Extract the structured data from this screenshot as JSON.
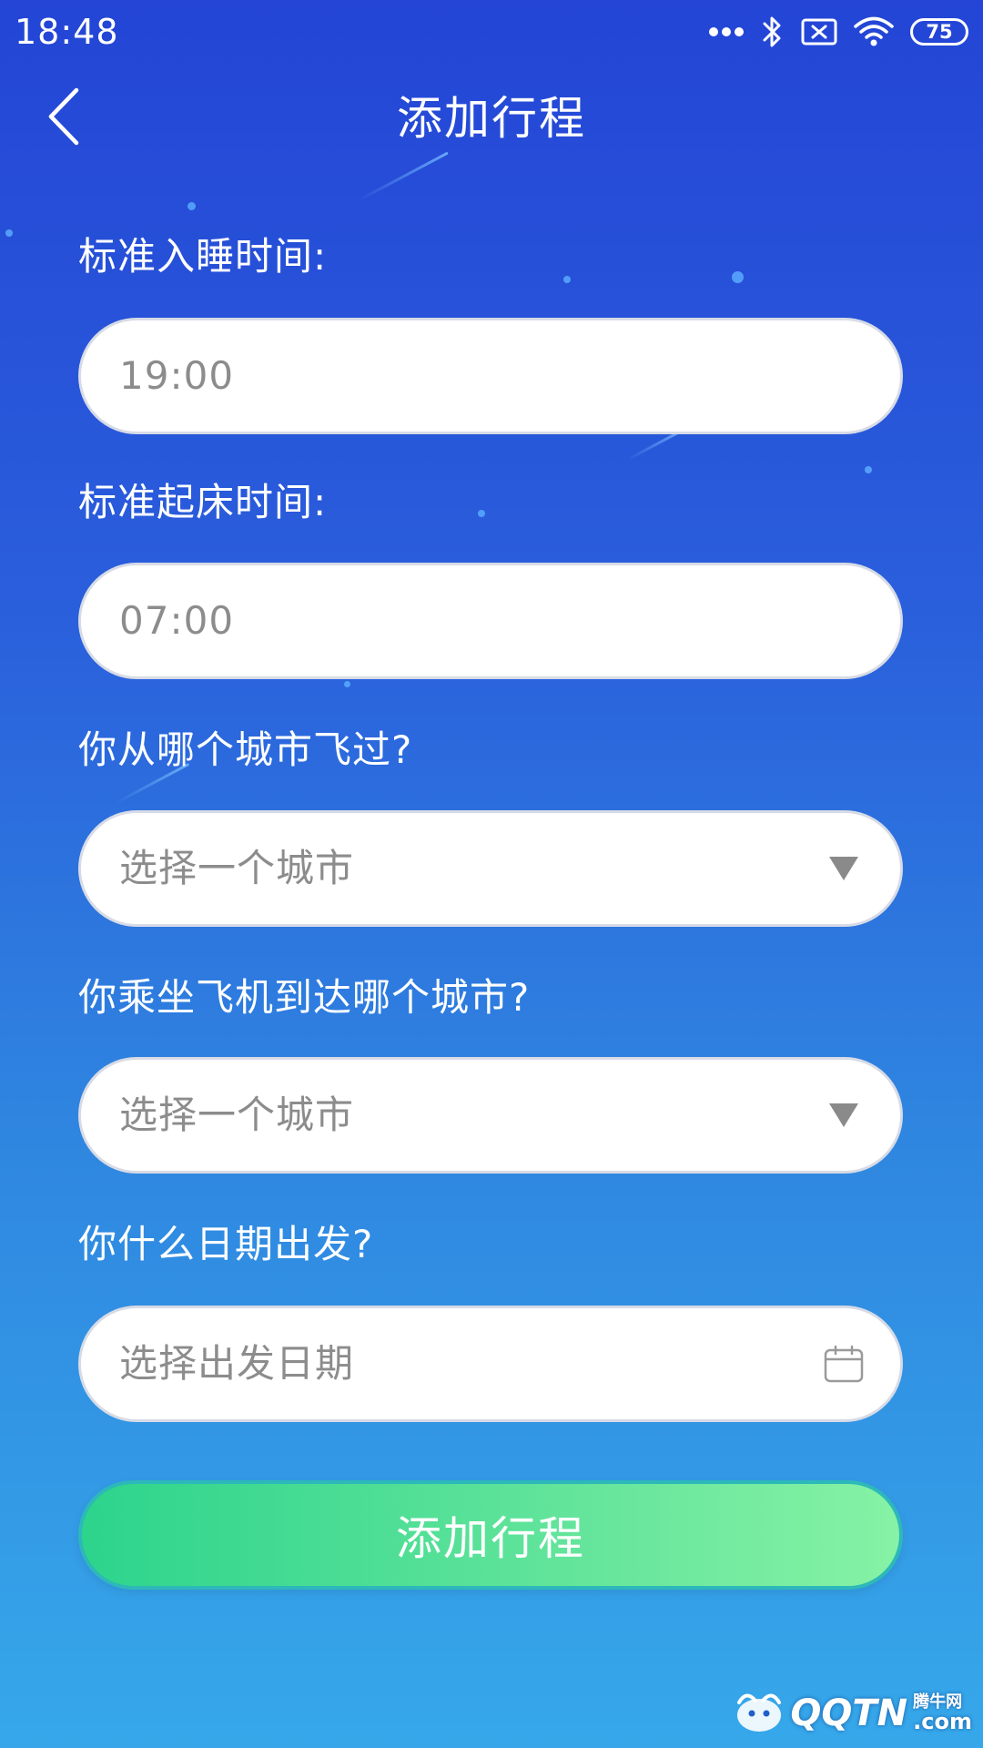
{
  "status_bar": {
    "time": "18:48",
    "battery": "75",
    "icons": [
      "more-dots-icon",
      "bluetooth-icon",
      "no-sim-icon",
      "wifi-icon",
      "battery-icon"
    ]
  },
  "header": {
    "title": "添加行程",
    "back_icon": "chevron-left-icon"
  },
  "form": {
    "sleep_time": {
      "label": "标准入睡时间:",
      "value": "19:00"
    },
    "wake_time": {
      "label": "标准起床时间:",
      "value": "07:00"
    },
    "departure_city": {
      "label": "你从哪个城市飞过?",
      "placeholder": "选择一个城市",
      "icon": "dropdown-triangle-icon"
    },
    "arrival_city": {
      "label": "你乘坐飞机到达哪个城市?",
      "placeholder": "选择一个城市",
      "icon": "dropdown-triangle-icon"
    },
    "departure_date": {
      "label": "你什么日期出发?",
      "placeholder": "选择出发日期",
      "icon": "calendar-icon"
    }
  },
  "submit": {
    "label": "添加行程"
  },
  "watermark": {
    "text": "QQTN",
    "suffix": ".com",
    "small": "腾牛网"
  },
  "colors": {
    "background_top": "#2445d6",
    "background_bottom": "#36a8ea",
    "button_start": "#2dd48c",
    "button_end": "#86f2a5",
    "placeholder": "#8c8c8c"
  }
}
